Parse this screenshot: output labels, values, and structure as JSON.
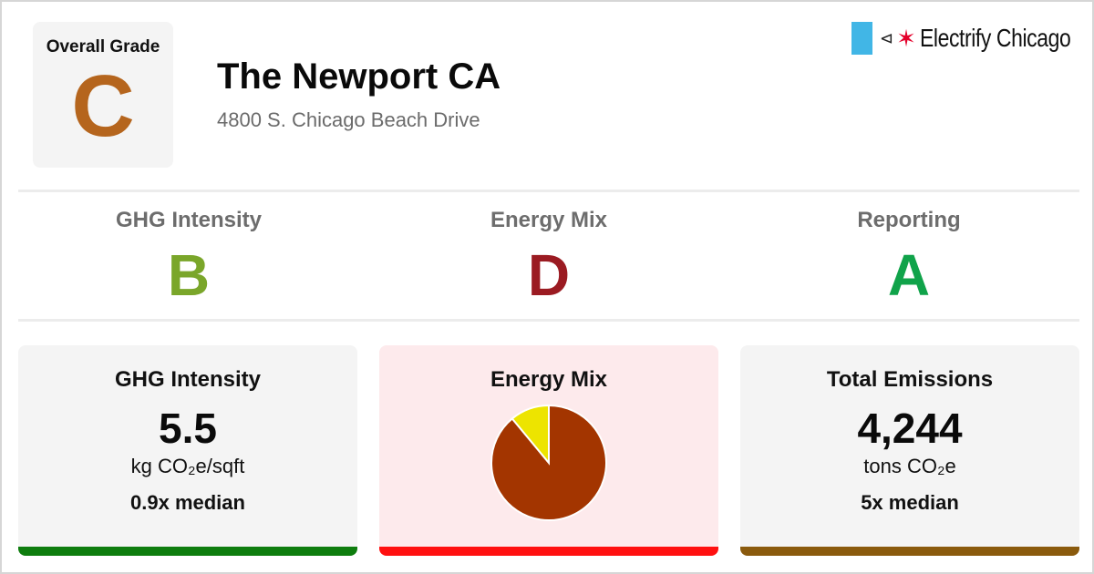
{
  "overall": {
    "label": "Overall Grade",
    "grade": "C",
    "color": "#b5651d"
  },
  "building": {
    "name": "The Newport CA",
    "address": "4800 S. Chicago Beach Drive"
  },
  "brand": {
    "name": "Electrify Chicago",
    "icons": [
      "flag-bar-icon",
      "plug-icon",
      "star-icon"
    ],
    "accent": "#41b6e6",
    "star_color": "#e4002b"
  },
  "subgrades": [
    {
      "label": "GHG Intensity",
      "grade": "B",
      "color": "#7aa62a"
    },
    {
      "label": "Energy Mix",
      "grade": "D",
      "color": "#9b1b22"
    },
    {
      "label": "Reporting",
      "grade": "A",
      "color": "#10a34a"
    }
  ],
  "cards": {
    "ghg": {
      "title": "GHG Intensity",
      "value": "5.5",
      "unit": "kg CO₂e/sqft",
      "median": "0.9x median",
      "bar_color": "#0e7d0e",
      "bg": "#f4f4f4"
    },
    "mix": {
      "title": "Energy Mix",
      "bar_color": "#ff1010",
      "bg": "#fdeaec"
    },
    "emissions": {
      "title": "Total Emissions",
      "value": "4,244",
      "unit": "tons CO₂e",
      "median": "5x median",
      "bar_color": "#8a5a0d",
      "bg": "#f4f4f4"
    }
  },
  "chart_data": {
    "type": "pie",
    "slices": [
      {
        "value": 0.89,
        "color": "#a33500"
      },
      {
        "value": 0.11,
        "color": "#ede400"
      }
    ]
  }
}
